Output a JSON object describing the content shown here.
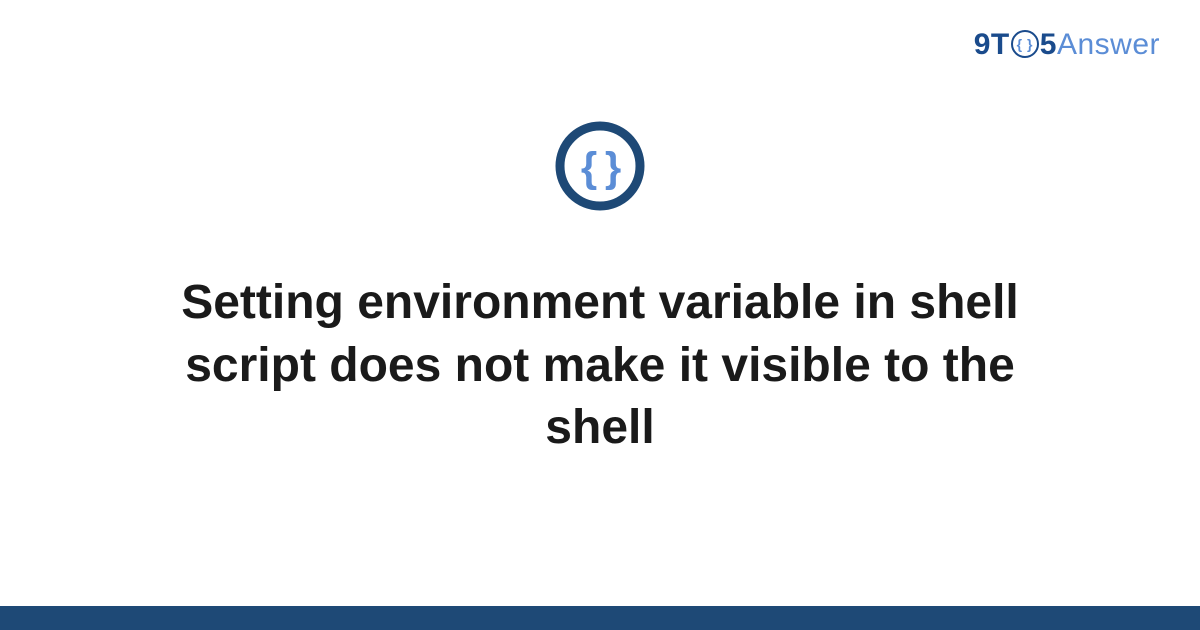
{
  "brand": {
    "prefix": "9T",
    "zero_glyph": "{ }",
    "five": "5",
    "suffix": "Answer"
  },
  "icon": {
    "ring_color": "#1e4976",
    "brace_color": "#5b8dd6"
  },
  "title": "Setting environment variable in shell script does not make it visible to the shell",
  "colors": {
    "bottom_bar": "#1e4976"
  }
}
